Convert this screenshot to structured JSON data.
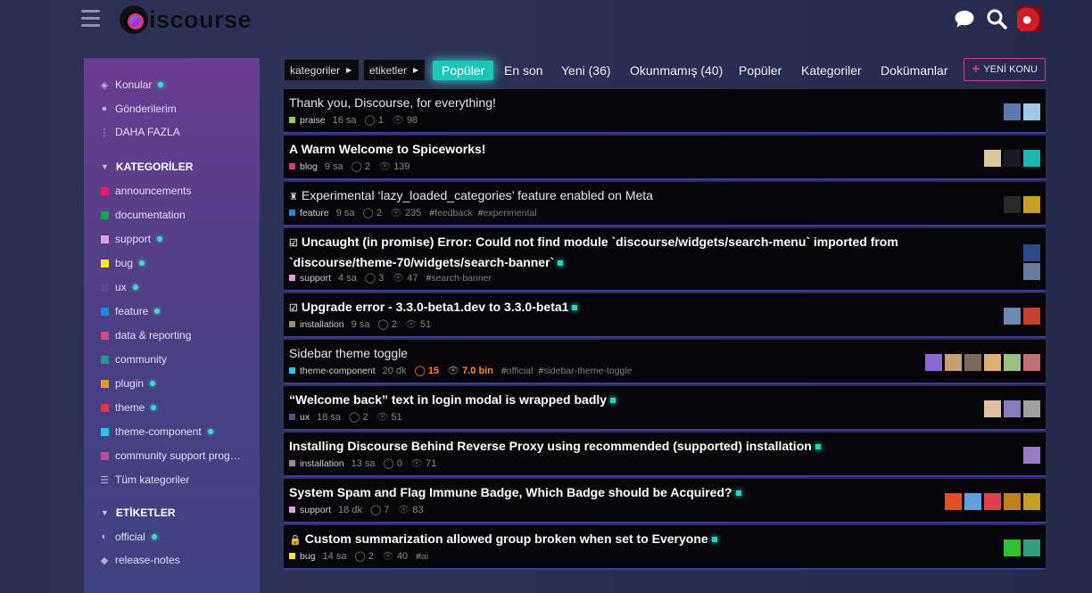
{
  "header": {
    "logo_text": "iscourse",
    "icons": [
      "chat-icon",
      "search-icon"
    ]
  },
  "sidebar": {
    "top": [
      {
        "icon": "layers-icon",
        "label": "Konular",
        "dot": true
      },
      {
        "icon": "user-icon",
        "label": "Gönderilerim",
        "dot": false
      },
      {
        "icon": "more-vertical-icon",
        "label": "DAHA FAZLA",
        "dot": false
      }
    ],
    "categories_heading": "KATEGORİLER",
    "categories": [
      {
        "label": "announcements",
        "color": "#e91e63",
        "dot": false
      },
      {
        "label": "documentation",
        "color": "#1ea34a",
        "dot": false
      },
      {
        "label": "support",
        "color": "#d9a3d9",
        "dot": true
      },
      {
        "label": "bug",
        "color": "#ffe81f",
        "dot": true
      },
      {
        "label": "ux",
        "color": "#5b4a8f",
        "dot": true
      },
      {
        "label": "feature",
        "color": "#1e88e5",
        "dot": true
      },
      {
        "label": "data & reporting",
        "color": "#e2447a",
        "dot": false
      },
      {
        "label": "community",
        "color": "#21998a",
        "dot": false
      },
      {
        "label": "plugin",
        "color": "#f7941d",
        "dot": true
      },
      {
        "label": "theme",
        "color": "#e53935",
        "dot": true
      },
      {
        "label": "theme-component",
        "color": "#22c7f0",
        "dot": true
      },
      {
        "label": "community support prog…",
        "color": "#b24ea0",
        "dot": false
      },
      {
        "label": "Tüm kategoriler",
        "color": "",
        "dot": false
      }
    ],
    "tags_heading": "ETİKETLER",
    "tags": [
      {
        "label": "official",
        "icon": "discourse-icon",
        "dot": true
      },
      {
        "label": "release-notes",
        "icon": "tag-icon",
        "dot": false
      }
    ]
  },
  "nav": {
    "categories_dropdown": "kategoriler",
    "tags_dropdown": "etiketler",
    "tabs": [
      "Popüler",
      "En son",
      "Yeni (36)",
      "Okunmamış (40)",
      "Popüler",
      "Kategoriler",
      "Dokümanlar"
    ],
    "new_topic": "YENİ KONU"
  },
  "topics": [
    {
      "title": "Thank you, Discourse, for everything!",
      "bold": false,
      "prefix": "",
      "category": "praise",
      "cat_color": "#9ccc3a",
      "age": "16 sa",
      "replies": "1",
      "views": "98",
      "tags": [],
      "new": false,
      "hot": false,
      "posters": [
        "#5b7bb0",
        "#9fc9e8"
      ]
    },
    {
      "title": "A Warm Welcome to Spiceworks!",
      "bold": true,
      "prefix": "",
      "category": "blog",
      "cat_color": "#e0338a",
      "age": "9 sa",
      "replies": "2",
      "views": "139",
      "tags": [],
      "new": false,
      "hot": false,
      "posters": [
        "#d8c8a0",
        "#1a1a22",
        "#19b6b0"
      ]
    },
    {
      "title": "Experimental ‘lazy_loaded_categories’ feature enabled on Meta",
      "bold": false,
      "prefix": "♜",
      "category": "feature",
      "cat_color": "#1e88e5",
      "age": "9 sa",
      "replies": "2",
      "views": "235",
      "tags": [
        "feedback",
        "experimental"
      ],
      "new": false,
      "hot": false,
      "posters": [
        "#2a2a2a",
        "#c8a020"
      ]
    },
    {
      "title": "Uncaught (in promise) Error: Could not find module `discourse/widgets/search-menu` imported from `discourse/theme-70/widgets/search-banner`",
      "bold": true,
      "prefix": "☑",
      "category": "support",
      "cat_color": "#d9a3d9",
      "age": "4 sa",
      "replies": "3",
      "views": "47",
      "tags": [
        "search-banner"
      ],
      "new": true,
      "hot": false,
      "posters": [
        "#2a4a8a",
        "#6a7a9a"
      ]
    },
    {
      "title": "Upgrade error - 3.3.0-beta1.dev to 3.3.0-beta1",
      "bold": true,
      "prefix": "☑",
      "category": "installation",
      "cat_color": "#9a8a80",
      "age": "9 sa",
      "replies": "2",
      "views": "51",
      "tags": [],
      "new": true,
      "hot": false,
      "posters": [
        "#6e88b0",
        "#c8402a"
      ]
    },
    {
      "title": "Sidebar theme toggle",
      "bold": false,
      "prefix": "",
      "category": "theme-component",
      "cat_color": "#22c7f0",
      "age": "20 dk",
      "replies": "15",
      "views": "7.0 bin",
      "tags": [
        "official",
        "sidebar-theme-toggle"
      ],
      "new": false,
      "hot": true,
      "posters": [
        "#8a6ad0",
        "#c8a070",
        "#7a6a5a",
        "#e0b070",
        "#9ac080",
        "#c07070"
      ]
    },
    {
      "title": "“Welcome back” text in login modal is wrapped badly",
      "bold": true,
      "prefix": "",
      "category": "ux",
      "cat_color": "#5b4a8f",
      "age": "18 sa",
      "replies": "2",
      "views": "51",
      "tags": [],
      "new": true,
      "hot": false,
      "posters": [
        "#e0c0a0",
        "#8a7ac0",
        "#a0a0a0"
      ]
    },
    {
      "title": "Installing Discourse Behind Reverse Proxy using recommended (supported) installation",
      "bold": true,
      "prefix": "",
      "category": "installation",
      "cat_color": "#9a8a80",
      "age": "13 sa",
      "replies": "0",
      "views": "71",
      "tags": [],
      "new": true,
      "hot": false,
      "posters": [
        "#9a7ac8"
      ]
    },
    {
      "title": "System Spam and Flag Immune Badge, Which Badge should be Acquired?",
      "bold": true,
      "prefix": "",
      "category": "support",
      "cat_color": "#d9a3d9",
      "age": "18 dk",
      "replies": "7",
      "views": "83",
      "tags": [],
      "new": true,
      "hot": false,
      "posters": [
        "#e05020",
        "#60a0e0",
        "#e04050",
        "#c08020",
        "#c8a020"
      ]
    },
    {
      "title": "Custom summarization allowed group broken when set to Everyone",
      "bold": true,
      "prefix": "🔒",
      "category": "bug",
      "cat_color": "#ffe81f",
      "age": "14 sa",
      "replies": "2",
      "views": "40",
      "tags": [
        "ai"
      ],
      "new": true,
      "hot": false,
      "posters": [
        "#30c030",
        "#30a080"
      ]
    }
  ]
}
